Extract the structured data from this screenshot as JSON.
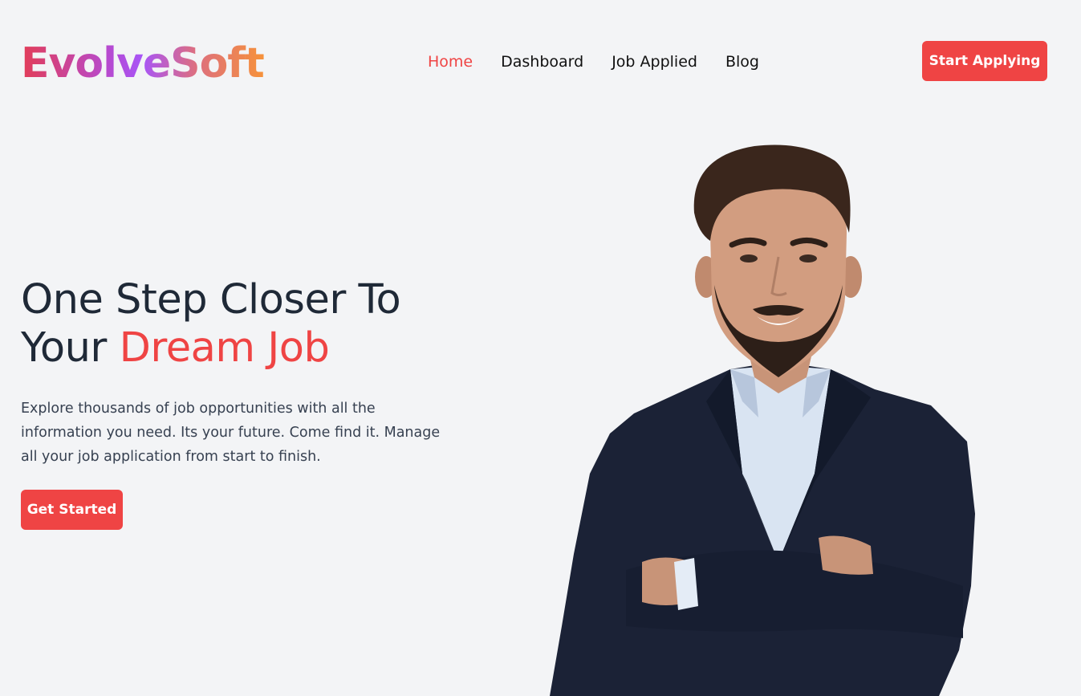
{
  "brand": {
    "name": "EvolveSoft"
  },
  "nav": {
    "items": [
      {
        "label": "Home",
        "active": true
      },
      {
        "label": "Dashboard",
        "active": false
      },
      {
        "label": "Job Applied",
        "active": false
      },
      {
        "label": "Blog",
        "active": false
      }
    ],
    "cta_label": "Start Applying"
  },
  "hero": {
    "title_line1": "One Step Closer To",
    "title_line2_prefix": "Your ",
    "title_line2_accent": "Dream Job",
    "description": "Explore thousands of job opportunities with all the information you need. Its your future. Come find it. Manage all your job application from start to finish.",
    "cta_label": "Get Started",
    "image": "smiling-man-in-suit-photo"
  },
  "colors": {
    "accent": "#ef4444",
    "background": "#f3f4f6",
    "heading": "#1f2937",
    "body_text": "#374151"
  }
}
